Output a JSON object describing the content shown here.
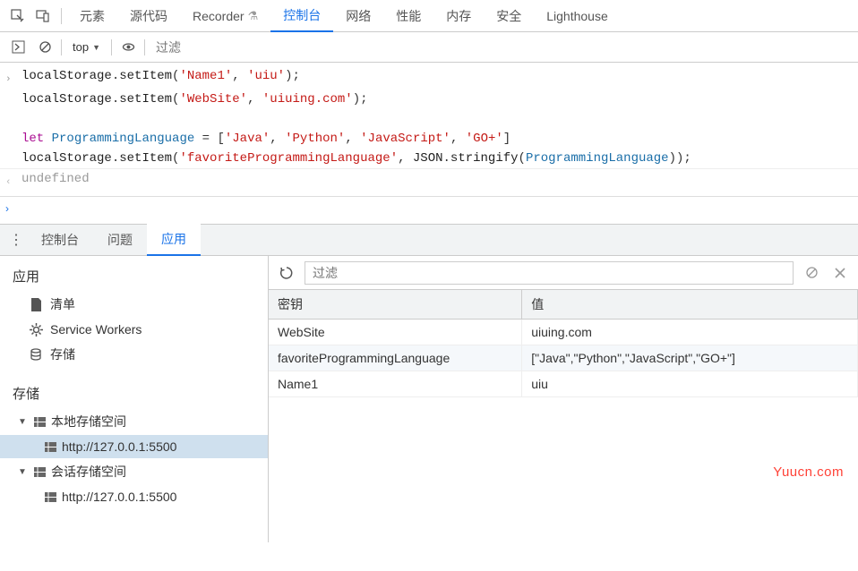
{
  "topTabs": {
    "elements": "元素",
    "sources": "源代码",
    "recorder": "Recorder",
    "console": "控制台",
    "network": "网络",
    "performance": "性能",
    "memory": "内存",
    "security": "安全",
    "lighthouse": "Lighthouse"
  },
  "consoleToolbar": {
    "context": "top",
    "filterPlaceholder": "过滤"
  },
  "console": {
    "line1_obj": "localStorage",
    "line1_dot": ".",
    "line1_fn": "setItem",
    "line1_open": "(",
    "line1_s1": "'Name1'",
    "line1_c1": ", ",
    "line1_s2": "'uiu'",
    "line1_close": ");",
    "line2_obj": "localStorage",
    "line2_dot": ".",
    "line2_fn": "setItem",
    "line2_open": "(",
    "line2_s1": "'WebSite'",
    "line2_c1": ", ",
    "line2_s2": "'uiuing.com'",
    "line2_close": ");",
    "line4_kw": "let",
    "line4_sp": " ",
    "line4_var": "ProgrammingLanguage",
    "line4_eq": " = [",
    "line4_s1": "'Java'",
    "line4_c1": ", ",
    "line4_s2": "'Python'",
    "line4_c2": ", ",
    "line4_s3": "'JavaScript'",
    "line4_c3": ", ",
    "line4_s4": "'GO+'",
    "line4_end": "]",
    "line5_obj": "localStorage",
    "line5_dot": ".",
    "line5_fn": "setItem",
    "line5_open": "(",
    "line5_s1": "'favoriteProgrammingLanguage'",
    "line5_c1": ", ",
    "line5_json": "JSON",
    "line5_dot2": ".",
    "line5_strfn": "stringify",
    "line5_open2": "(",
    "line5_arg": "ProgrammingLanguage",
    "line5_close": "));",
    "result": "undefined"
  },
  "drawerTabs": {
    "console": "控制台",
    "issues": "问题",
    "application": "应用"
  },
  "sidebar": {
    "sectionApp": "应用",
    "manifest": "清单",
    "serviceWorkers": "Service Workers",
    "storage": "存储",
    "sectionStorage": "存储",
    "localStorage": "本地存储空间",
    "localStorageChild": "http://127.0.0.1:5500",
    "sessionStorage": "会话存储空间",
    "sessionStorageChild": "http://127.0.0.1:5500"
  },
  "storageToolbar": {
    "filterPlaceholder": "过滤"
  },
  "storageTable": {
    "keyHeader": "密钥",
    "valueHeader": "值",
    "rows": [
      {
        "key": "WebSite",
        "value": "uiuing.com"
      },
      {
        "key": "favoriteProgrammingLanguage",
        "value": "[\"Java\",\"Python\",\"JavaScript\",\"GO+\"]"
      },
      {
        "key": "Name1",
        "value": "uiu"
      }
    ]
  },
  "watermark": "Yuucn.com"
}
